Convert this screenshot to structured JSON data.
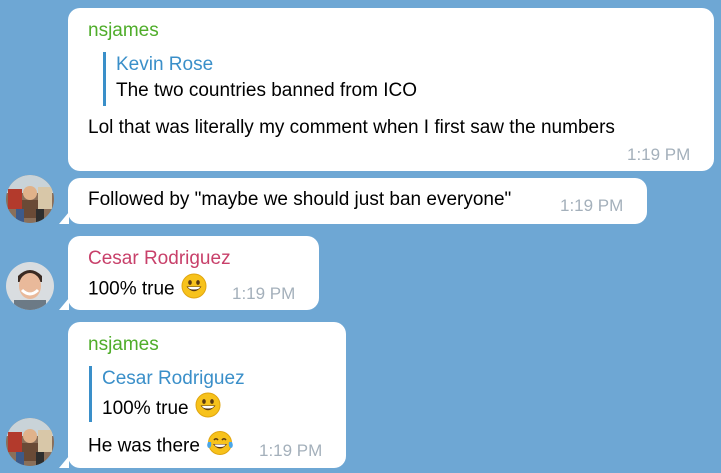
{
  "messages": [
    {
      "sender": "nsjames",
      "quote_author": "Kevin Rose",
      "quote_text": "The two countries banned from ICO",
      "text": "Lol that was literally my comment when I first saw the numbers",
      "time": "1:19 PM"
    },
    {
      "text": "Followed by \"maybe we should just ban everyone\"",
      "time": "1:19 PM"
    },
    {
      "sender": "Cesar Rodriguez",
      "text": "100% true",
      "emoji": "grinning-face-emoji",
      "time": "1:19 PM"
    },
    {
      "sender": "nsjames",
      "quote_author": "Cesar Rodriguez",
      "quote_text": "100% true",
      "quote_emoji": "grinning-face-emoji",
      "text": "He was there",
      "emoji": "tears-of-joy-emoji",
      "time": "1:19 PM"
    }
  ],
  "colors": {
    "background": "#6ea7d4",
    "nsjames_name": "#4fad2a",
    "cesar_name": "#c8406a",
    "quote_accent": "#3a8fc9",
    "timestamp": "#a4b0bb"
  }
}
